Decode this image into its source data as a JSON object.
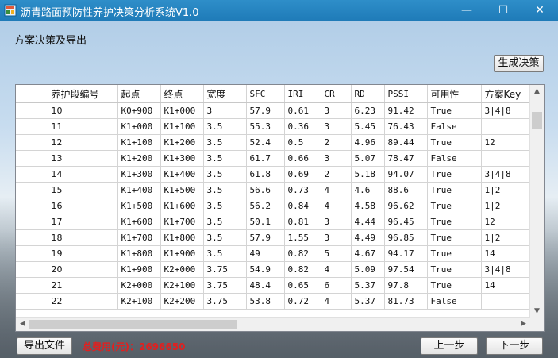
{
  "window": {
    "title": "沥青路面预防性养护决策分析系统V1.0",
    "controls": {
      "minimize": "—",
      "maximize": "☐",
      "close": "✕"
    }
  },
  "section_label": "方案决策及导出",
  "buttons": {
    "generate": "生成决策",
    "export": "导出文件",
    "prev": "上一步",
    "next": "下一步"
  },
  "total_cost": "总费用(元)：2696650",
  "table": {
    "columns": [
      "",
      "养护段编号",
      "起点",
      "终点",
      "宽度",
      "SFC",
      "IRI",
      "CR",
      "RD",
      "PSSI",
      "可用性",
      "方案Key"
    ],
    "rows": [
      [
        "10",
        "K0+900",
        "K1+000",
        "3",
        "57.9",
        "0.61",
        "3",
        "6.23",
        "91.42",
        "True",
        "3|4|8"
      ],
      [
        "11",
        "K1+000",
        "K1+100",
        "3.5",
        "55.3",
        "0.36",
        "3",
        "5.45",
        "76.43",
        "False",
        ""
      ],
      [
        "12",
        "K1+100",
        "K1+200",
        "3.5",
        "52.4",
        "0.5",
        "2",
        "4.96",
        "89.44",
        "True",
        "12"
      ],
      [
        "13",
        "K1+200",
        "K1+300",
        "3.5",
        "61.7",
        "0.66",
        "3",
        "5.07",
        "78.47",
        "False",
        ""
      ],
      [
        "14",
        "K1+300",
        "K1+400",
        "3.5",
        "61.8",
        "0.69",
        "2",
        "5.18",
        "94.07",
        "True",
        "3|4|8"
      ],
      [
        "15",
        "K1+400",
        "K1+500",
        "3.5",
        "56.6",
        "0.73",
        "4",
        "4.6",
        "88.6",
        "True",
        "1|2"
      ],
      [
        "16",
        "K1+500",
        "K1+600",
        "3.5",
        "56.2",
        "0.84",
        "4",
        "4.58",
        "96.62",
        "True",
        "1|2"
      ],
      [
        "17",
        "K1+600",
        "K1+700",
        "3.5",
        "50.1",
        "0.81",
        "3",
        "4.44",
        "96.45",
        "True",
        "12"
      ],
      [
        "18",
        "K1+700",
        "K1+800",
        "3.5",
        "57.9",
        "1.55",
        "3",
        "4.49",
        "96.85",
        "True",
        "1|2"
      ],
      [
        "19",
        "K1+800",
        "K1+900",
        "3.5",
        "49",
        "0.82",
        "5",
        "4.67",
        "94.17",
        "True",
        "14"
      ],
      [
        "20",
        "K1+900",
        "K2+000",
        "3.75",
        "54.9",
        "0.82",
        "4",
        "5.09",
        "97.54",
        "True",
        "3|4|8"
      ],
      [
        "21",
        "K2+000",
        "K2+100",
        "3.75",
        "48.4",
        "0.65",
        "6",
        "5.37",
        "97.8",
        "True",
        "14"
      ],
      [
        "22",
        "K2+100",
        "K2+200",
        "3.75",
        "53.8",
        "0.72",
        "4",
        "5.37",
        "81.73",
        "False",
        ""
      ]
    ]
  },
  "colors": {
    "titlebar": "#1f7bb8",
    "total_cost": "#e02020"
  }
}
